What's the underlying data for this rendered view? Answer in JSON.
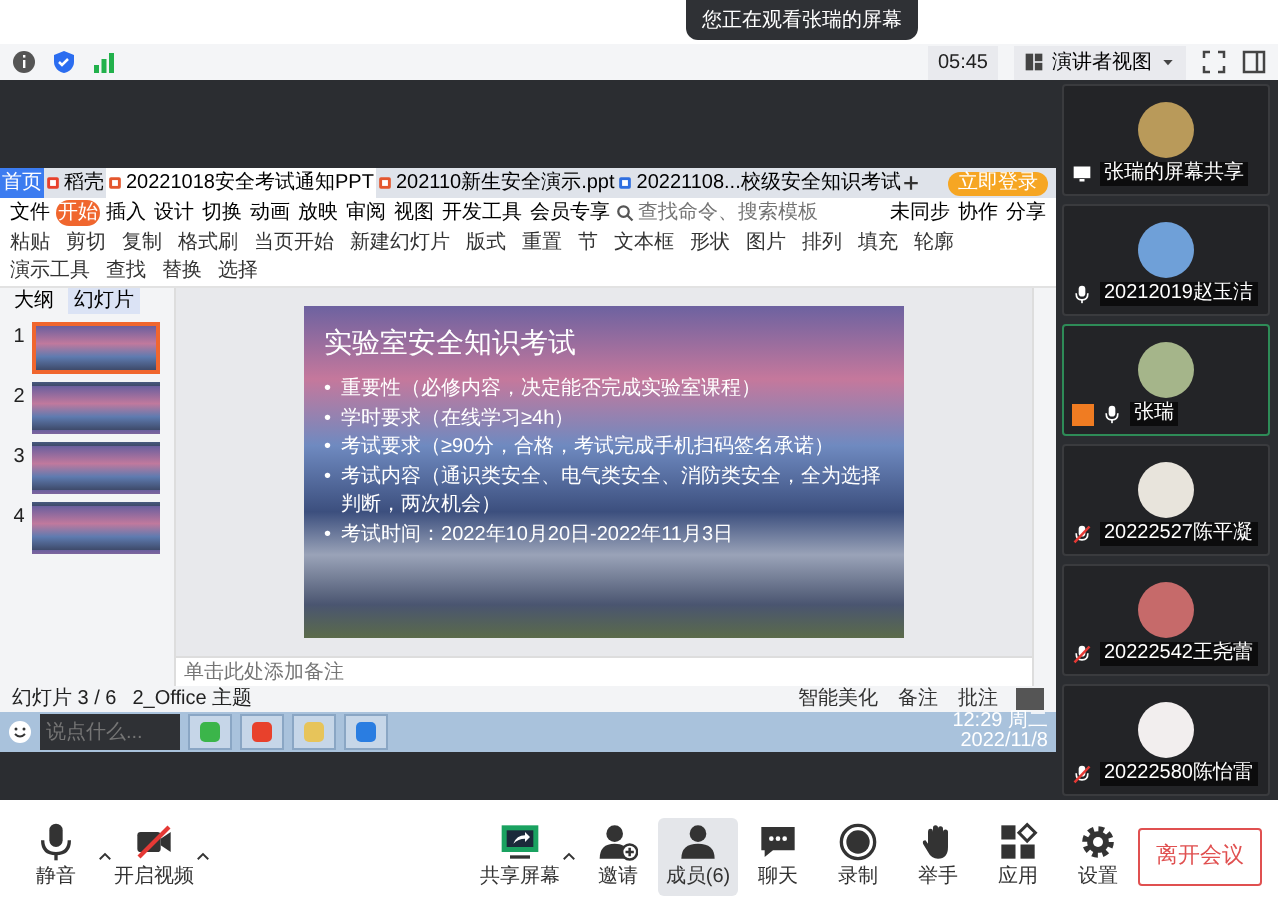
{
  "notice": {
    "text": "您正在观看张瑞的屏幕"
  },
  "top_toolbar": {
    "timer": "05:45",
    "view_mode": "演讲者视图"
  },
  "wps": {
    "tabs": [
      {
        "label": "首页",
        "kind": "home",
        "selected": false
      },
      {
        "label": "稻壳",
        "kind": "docer",
        "selected": false
      },
      {
        "label": "20221018安全考试通知PPT",
        "kind": "ppt",
        "selected": true
      },
      {
        "label": "202110新生安全演示.ppt",
        "kind": "ppt",
        "selected": false
      },
      {
        "label": "20221108...校级安全知识考试",
        "kind": "doc",
        "selected": false
      }
    ],
    "login": "立即登录",
    "file_menu": "文件",
    "menu_tabs": [
      {
        "label": "开始",
        "selected": true
      },
      {
        "label": "插入",
        "selected": false
      },
      {
        "label": "设计",
        "selected": false
      },
      {
        "label": "切换",
        "selected": false
      },
      {
        "label": "动画",
        "selected": false
      },
      {
        "label": "放映",
        "selected": false
      },
      {
        "label": "审阅",
        "selected": false
      },
      {
        "label": "视图",
        "selected": false
      },
      {
        "label": "开发工具",
        "selected": false
      },
      {
        "label": "会员专享",
        "selected": false
      }
    ],
    "search": {
      "placeholder": "查找命令、搜索模板"
    },
    "menu_actions": [
      "未同步",
      "协作",
      "分享"
    ],
    "ribbon": [
      "粘贴",
      "剪切",
      "复制",
      "格式刷",
      "当页开始",
      "新建幻灯片",
      "版式",
      "重置",
      "节",
      "文本框",
      "形状",
      "图片",
      "排列",
      "填充",
      "轮廓",
      "演示工具",
      "查找",
      "替换",
      "选择"
    ],
    "panel_tabs": [
      {
        "label": "大纲",
        "selected": false
      },
      {
        "label": "幻灯片",
        "selected": true
      }
    ],
    "thumbnails": [
      {
        "number": "1",
        "selected": true
      },
      {
        "number": "2",
        "selected": false
      },
      {
        "number": "3",
        "selected": false
      },
      {
        "number": "4",
        "selected": false
      }
    ],
    "slide": {
      "title": "实验室安全知识考试",
      "bullet_marker": "•",
      "bullets": [
        "重要性（必修内容，决定能否完成实验室课程）",
        "学时要求（在线学习≥4h）",
        "考试要求（≥90分，合格，考试完成手机扫码签名承诺）",
        "考试内容（通识类安全、电气类安全、消防类安全，全为选择判断，两次机会）",
        "考试时间：2022年10月20日-2022年11月3日"
      ]
    },
    "notes": {
      "placeholder": "单击此处添加备注"
    },
    "status": {
      "slide_count": "幻灯片 3 / 6",
      "theme": "2_Office 主题",
      "actions": [
        "智能美化",
        "备注",
        "批注"
      ]
    }
  },
  "taskbar": {
    "chat": {
      "placeholder": "说点什么..."
    },
    "time": "12:29 周二",
    "date": "2022/11/8"
  },
  "participants": [
    {
      "name": "张瑞的屏幕共享",
      "kind": "screen",
      "active": false,
      "host": false
    },
    {
      "name": "20212019赵玉洁",
      "kind": "mic",
      "active": false,
      "host": false
    },
    {
      "name": "张瑞",
      "kind": "mic",
      "active": true,
      "host": true
    },
    {
      "name": "20222527陈平凝",
      "kind": "mic-muted",
      "active": false,
      "host": false
    },
    {
      "name": "20222542王尧蕾",
      "kind": "mic-muted",
      "active": false,
      "host": false
    },
    {
      "name": "20222580陈怡雷",
      "kind": "mic-muted",
      "active": false,
      "host": false
    }
  ],
  "controls": [
    {
      "label": "静音",
      "kind": "mic",
      "has_menu": true,
      "selected": false
    },
    {
      "label": "开启视频",
      "kind": "camera",
      "has_menu": true,
      "selected": false
    },
    {
      "label": "共享屏幕",
      "kind": "share",
      "has_menu": true,
      "selected": false
    },
    {
      "label": "邀请",
      "kind": "invite",
      "has_menu": false,
      "selected": false
    },
    {
      "label": "成员(6)",
      "kind": "members",
      "has_menu": false,
      "selected": true
    },
    {
      "label": "聊天",
      "kind": "chat",
      "has_menu": false,
      "selected": false
    },
    {
      "label": "录制",
      "kind": "record",
      "has_menu": false,
      "selected": false
    },
    {
      "label": "举手",
      "kind": "hand",
      "has_menu": false,
      "selected": false
    },
    {
      "label": "应用",
      "kind": "apps",
      "has_menu": false,
      "selected": false
    },
    {
      "label": "设置",
      "kind": "settings",
      "has_menu": false,
      "selected": false
    }
  ],
  "leave_button": "离开会议"
}
